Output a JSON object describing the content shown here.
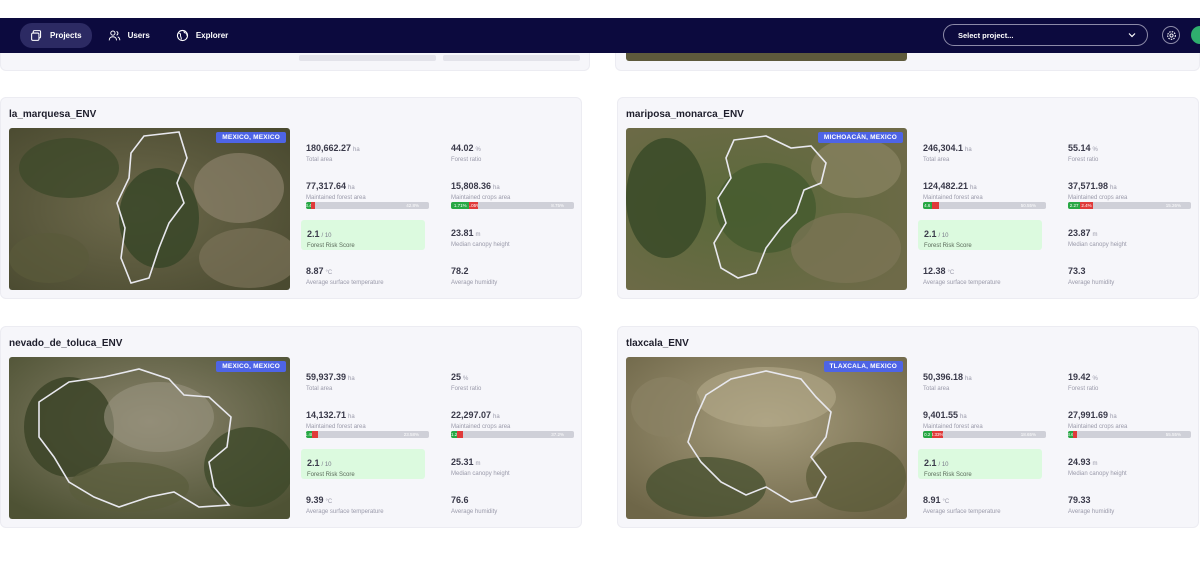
{
  "nav": {
    "items": [
      {
        "label": "Projects",
        "icon": "projects-icon",
        "active": true
      },
      {
        "label": "Users",
        "icon": "users-icon",
        "active": false
      },
      {
        "label": "Explorer",
        "icon": "globe-icon",
        "active": false
      }
    ],
    "select_placeholder": "Select project..."
  },
  "colors": {
    "nav_bg": "#0c0a3e",
    "badge": "#4e64e6",
    "risk_bg": "#dcfadf",
    "green": "#27a844",
    "red": "#e03a3a"
  },
  "cards": [
    {
      "title": "la_marquesa_ENV",
      "location": "MEXICO, MEXICO",
      "total_area": {
        "value": "180,662.27",
        "unit": "ha",
        "label": "Total area"
      },
      "forest_ratio": {
        "value": "44.02",
        "unit": "%",
        "label": "Forest ratio"
      },
      "forest_area": {
        "value": "77,317.64",
        "unit": "ha",
        "label": "Maintained forest area",
        "seg1": "3.4",
        "seg2": "",
        "rest": "42.8%",
        "seg1_pct": 0.04,
        "seg2_pct": 0.03
      },
      "crops_area": {
        "value": "15,808.36",
        "unit": "ha",
        "label": "Maintained crops area",
        "seg1": "1.71%",
        "seg2": "1.05%",
        "rest": "8.75%",
        "seg1_pct": 0.15,
        "seg2_pct": 0.07
      },
      "risk": {
        "value": "2.1",
        "unit": "/ 10",
        "label": "Forest Risk Score"
      },
      "canopy": {
        "value": "23.81",
        "unit": "m",
        "label": "Median canopy height"
      },
      "temp": {
        "value": "8.87",
        "unit": "°C",
        "label": "Average surface temperature"
      },
      "humidity": {
        "value": "78.2",
        "unit": "",
        "label": "Average humidity"
      }
    },
    {
      "title": "mariposa_monarca_ENV",
      "location": "MICHOACÁN, MEXICO",
      "total_area": {
        "value": "246,304.1",
        "unit": "ha",
        "label": "Total area"
      },
      "forest_ratio": {
        "value": "55.14",
        "unit": "%",
        "label": "Forest ratio"
      },
      "forest_area": {
        "value": "124,482.21",
        "unit": "ha",
        "label": "Maintained forest area",
        "seg1": "4.6",
        "seg2": "",
        "rest": "50.55%",
        "seg1_pct": 0.07,
        "seg2_pct": 0.06
      },
      "crops_area": {
        "value": "37,571.98",
        "unit": "ha",
        "label": "Maintained crops area",
        "seg1": "2.27",
        "seg2": "2.4%",
        "rest": "15.26%",
        "seg1_pct": 0.1,
        "seg2_pct": 0.1
      },
      "risk": {
        "value": "2.1",
        "unit": "/ 10",
        "label": "Forest Risk Score"
      },
      "canopy": {
        "value": "23.87",
        "unit": "m",
        "label": "Median canopy height"
      },
      "temp": {
        "value": "12.38",
        "unit": "°C",
        "label": "Average surface temperature"
      },
      "humidity": {
        "value": "73.3",
        "unit": "",
        "label": "Average humidity"
      }
    },
    {
      "title": "nevado_de_toluca_ENV",
      "location": "MEXICO, MEXICO",
      "total_area": {
        "value": "59,937.39",
        "unit": "ha",
        "label": "Total area"
      },
      "forest_ratio": {
        "value": "25",
        "unit": "%",
        "label": "Forest ratio"
      },
      "forest_area": {
        "value": "14,132.71",
        "unit": "ha",
        "label": "Maintained forest area",
        "seg1": "1.48",
        "seg2": "",
        "rest": "23.58%",
        "seg1_pct": 0.05,
        "seg2_pct": 0.05
      },
      "crops_area": {
        "value": "22,297.07",
        "unit": "ha",
        "label": "Maintained crops area",
        "seg1": "1.2",
        "seg2": "",
        "rest": "37.2%",
        "seg1_pct": 0.05,
        "seg2_pct": 0.05
      },
      "risk": {
        "value": "2.1",
        "unit": "/ 10",
        "label": "Forest Risk Score"
      },
      "canopy": {
        "value": "25.31",
        "unit": "m",
        "label": "Median canopy height"
      },
      "temp": {
        "value": "9.39",
        "unit": "°C",
        "label": "Average surface temperature"
      },
      "humidity": {
        "value": "76.6",
        "unit": "",
        "label": "Average humidity"
      }
    },
    {
      "title": "tlaxcala_ENV",
      "location": "TLAXCALA, MEXICO",
      "total_area": {
        "value": "50,396.18",
        "unit": "ha",
        "label": "Total area"
      },
      "forest_ratio": {
        "value": "19.42",
        "unit": "%",
        "label": "Forest ratio"
      },
      "forest_area": {
        "value": "9,401.55",
        "unit": "ha",
        "label": "Maintained forest area",
        "seg1": "0.2",
        "seg2": "3.33%",
        "rest": "18.65%",
        "seg1_pct": 0.07,
        "seg2_pct": 0.09
      },
      "crops_area": {
        "value": "27,991.69",
        "unit": "ha",
        "label": "Maintained crops area",
        "seg1": "3.6",
        "seg2": "",
        "rest": "55.55%",
        "seg1_pct": 0.04,
        "seg2_pct": 0.03
      },
      "risk": {
        "value": "2.1",
        "unit": "/ 10",
        "label": "Forest Risk Score"
      },
      "canopy": {
        "value": "24.93",
        "unit": "m",
        "label": "Median canopy height"
      },
      "temp": {
        "value": "8.91",
        "unit": "°C",
        "label": "Average surface temperature"
      },
      "humidity": {
        "value": "79.33",
        "unit": "",
        "label": "Average humidity"
      }
    }
  ]
}
